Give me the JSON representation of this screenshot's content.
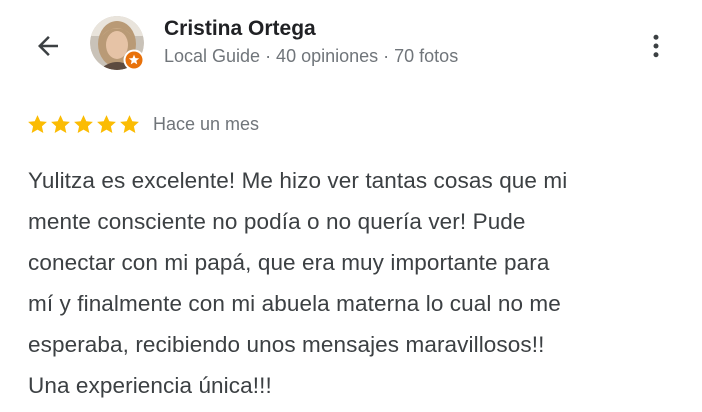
{
  "reviewer": {
    "name": "Cristina Ortega",
    "meta": "Local Guide · 40 opiniones · 70 fotos",
    "badge_icon": "local-guide-star-icon",
    "badge_color": "#e8710a"
  },
  "header": {
    "back_icon": "arrow-back-icon",
    "more_icon": "more-vert-icon"
  },
  "review": {
    "rating": 5,
    "rating_max": 5,
    "star_color": "#fbbc04",
    "time_ago": "Hace un mes",
    "text_lines": [
      "Yulitza es excelente! Me hizo ver tantas cosas que mi",
      "mente consciente no podía o no quería ver! Pude",
      "conectar con mi papá, que era muy importante para",
      "mí y finalmente con mi abuela materna lo cual no me",
      "esperaba, recibiendo unos mensajes maravillosos!!",
      "Una experiencia única!!!"
    ]
  }
}
